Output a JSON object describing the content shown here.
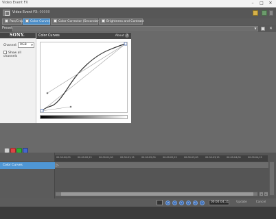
{
  "window": {
    "title": "Video Event FX",
    "minimize": "–",
    "maximize": "□",
    "close": "✕"
  },
  "fx_header": {
    "label": "Video Event FX:",
    "event_name": "00000"
  },
  "tabs": [
    {
      "label": "Pan/Crop"
    },
    {
      "label": "Color Curves"
    },
    {
      "label": "Color Corrector (Secondary)"
    },
    {
      "label": "Brightness and Contrast"
    }
  ],
  "preset": {
    "label": "Preset:",
    "value": ""
  },
  "sony_panel": {
    "logo": "SONY.",
    "channel_label": "Channel:",
    "channel_value": "RGB",
    "show_all_channels": "Show all channels"
  },
  "curves_panel": {
    "title": "Color Curves",
    "about": "About",
    "help": "?"
  },
  "timeline": {
    "ticks": [
      "00:00:00;00",
      "00:00:00;15",
      "00:00:01;00",
      "00:00:01;15",
      "00:00:02;00",
      "00:00:02;15",
      "00:00:03;00",
      "00:00:03;15",
      "00:00:04;00",
      "00:00:04;15"
    ],
    "track_label": "Color Curves"
  },
  "transport": {
    "timecode": "00:00:04;11",
    "button_1": "Update",
    "button_2": "Cancel"
  },
  "colors": {
    "accent": "#4f96d4",
    "panel_bg": "#6a6a6a",
    "curve": "#2b2b2b"
  }
}
